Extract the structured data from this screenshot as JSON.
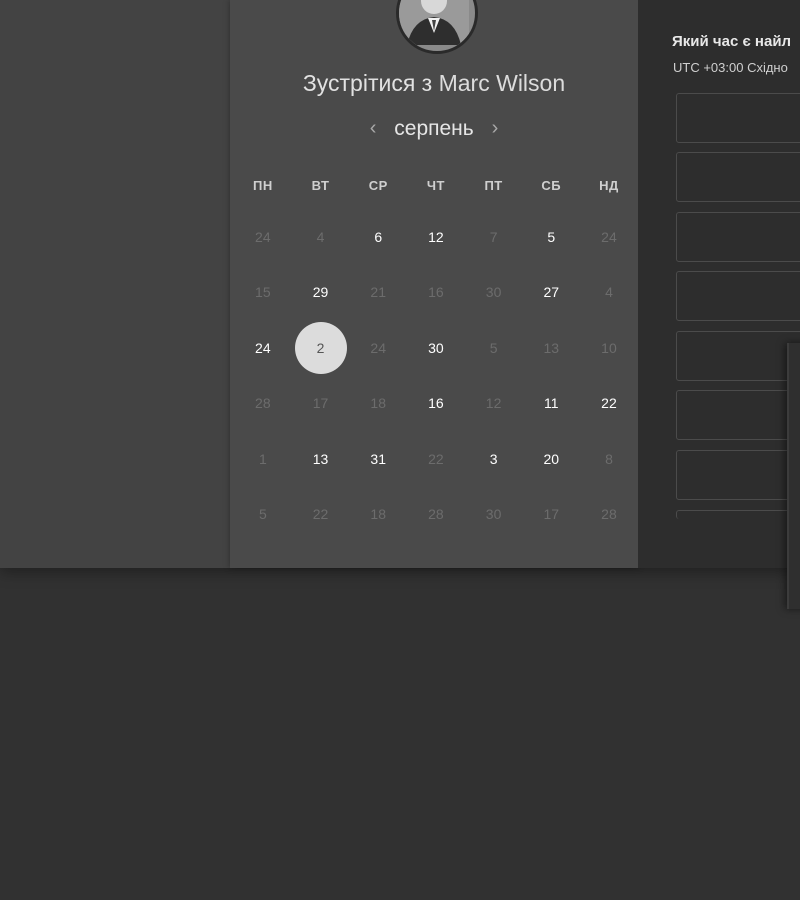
{
  "booking": {
    "title_prefix": "Зустрітися з",
    "host_name": "Marc Wilson",
    "avatar_icon": "person-avatar-icon"
  },
  "calendar": {
    "month": "серпень",
    "prev_icon": "chevron-left-icon",
    "next_icon": "chevron-right-icon",
    "weekdays": [
      "ПН",
      "ВТ",
      "СР",
      "ЧТ",
      "ПТ",
      "СБ",
      "НД"
    ],
    "weeks": [
      [
        {
          "d": "24",
          "off": true
        },
        {
          "d": "4",
          "off": true
        },
        {
          "d": "6",
          "off": false
        },
        {
          "d": "12",
          "off": false
        },
        {
          "d": "7",
          "off": true
        },
        {
          "d": "5",
          "off": false
        },
        {
          "d": "24",
          "off": true
        }
      ],
      [
        {
          "d": "15",
          "off": true
        },
        {
          "d": "29",
          "off": false
        },
        {
          "d": "21",
          "off": true
        },
        {
          "d": "16",
          "off": true
        },
        {
          "d": "30",
          "off": true
        },
        {
          "d": "27",
          "off": false
        },
        {
          "d": "4",
          "off": true
        }
      ],
      [
        {
          "d": "24",
          "off": false
        },
        {
          "d": "2",
          "off": false,
          "sel": true
        },
        {
          "d": "24",
          "off": true
        },
        {
          "d": "30",
          "off": false
        },
        {
          "d": "5",
          "off": true
        },
        {
          "d": "13",
          "off": true
        },
        {
          "d": "10",
          "off": true
        }
      ],
      [
        {
          "d": "28",
          "off": true
        },
        {
          "d": "17",
          "off": true
        },
        {
          "d": "18",
          "off": true
        },
        {
          "d": "16",
          "off": false
        },
        {
          "d": "12",
          "off": true
        },
        {
          "d": "11",
          "off": false
        },
        {
          "d": "22",
          "off": false
        }
      ],
      [
        {
          "d": "1",
          "off": true
        },
        {
          "d": "13",
          "off": false
        },
        {
          "d": "31",
          "off": false
        },
        {
          "d": "22",
          "off": true
        },
        {
          "d": "3",
          "off": false
        },
        {
          "d": "20",
          "off": false
        },
        {
          "d": "8",
          "off": true
        }
      ],
      [
        {
          "d": "5",
          "off": true
        },
        {
          "d": "22",
          "off": true
        },
        {
          "d": "18",
          "off": true
        },
        {
          "d": "28",
          "off": true
        },
        {
          "d": "30",
          "off": true
        },
        {
          "d": "17",
          "off": true
        },
        {
          "d": "28",
          "off": true
        }
      ]
    ]
  },
  "time_panel": {
    "title": "Який час є найл",
    "timezone": "UTC +03:00 Східно",
    "slots": [
      "",
      "",
      "",
      "",
      "",
      "",
      ""
    ]
  },
  "colors": {
    "page_bg": "#313131",
    "card_bg": "#4a4a4a",
    "selected_day": "#dcdcdc",
    "panel_bg": "#2d2d2d"
  }
}
